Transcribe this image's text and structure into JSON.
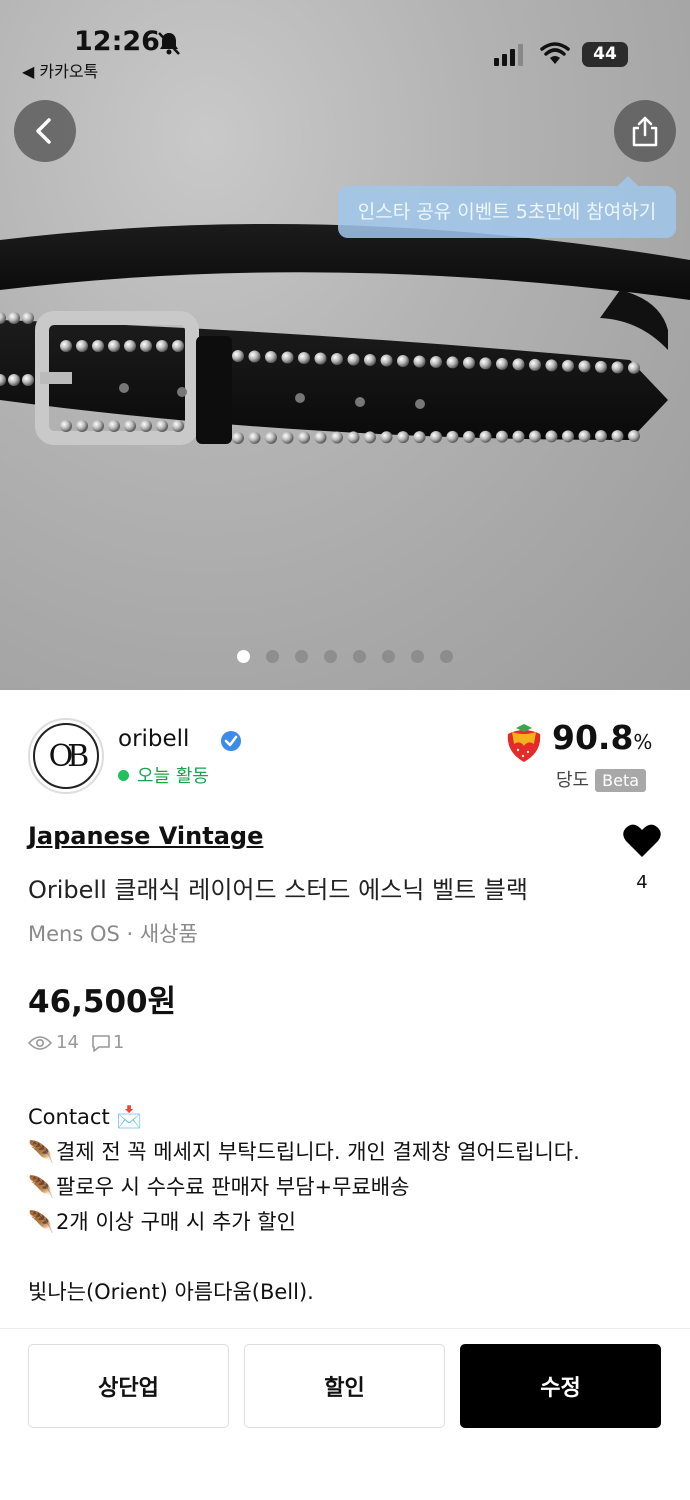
{
  "status_bar": {
    "time": "12:26",
    "back_app": "◀ 카카오톡",
    "battery": "44"
  },
  "tooltip": {
    "text": "인스타 공유 이벤트 5초만에 참여하기"
  },
  "gallery": {
    "dot_count": 8,
    "active_index": 0
  },
  "seller": {
    "name": "oribell",
    "avatar_text": "OB",
    "activity": "오늘 활동"
  },
  "rating": {
    "value": "90.8",
    "unit": "%",
    "label": "당도",
    "beta": "Beta"
  },
  "product": {
    "brand": "Japanese Vintage",
    "title": "Oribell 클래식 레이어드 스터드 에스닉 벨트 블랙",
    "meta": "Mens OS · 새상품",
    "price": "46,500원",
    "views": "14",
    "comments": "1",
    "likes": "4"
  },
  "description": {
    "lines": [
      "Contact 📩",
      "결제 전 꼭 메세지 부탁드립니다. 개인 결제창 열어드립니다.",
      "팔로우 시 수수료 판매자 부담+무료배송",
      "2개 이상 구매 시 추가 할인",
      "",
      "빛나는(Orient) 아름다움(Bell)."
    ]
  },
  "actions": {
    "bump": "상단업",
    "discount": "할인",
    "edit": "수정"
  }
}
